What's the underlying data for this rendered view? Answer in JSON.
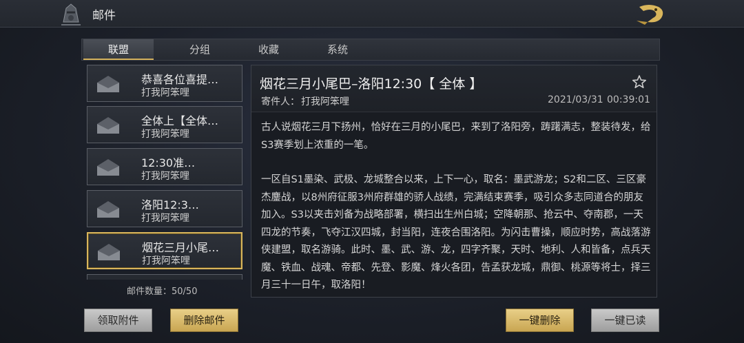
{
  "header": {
    "title": "邮件"
  },
  "tabs": [
    {
      "label": "联盟",
      "active": true
    },
    {
      "label": "分组",
      "active": false
    },
    {
      "label": "收藏",
      "active": false
    },
    {
      "label": "系统",
      "active": false
    }
  ],
  "mail_list": {
    "items": [
      {
        "subject": "恭喜各位喜提…",
        "sender": "打我阿笨哩",
        "selected": false
      },
      {
        "subject": "全体上【全体…",
        "sender": "打我阿笨哩",
        "selected": false
      },
      {
        "subject": "12:30准…",
        "sender": "打我阿笨哩",
        "selected": false
      },
      {
        "subject": "洛阳12:3…",
        "sender": "打我阿笨哩",
        "selected": false
      },
      {
        "subject": "烟花三月小尾…",
        "sender": "打我阿笨哩",
        "selected": true
      }
    ],
    "count_label": "邮件数量：50/50"
  },
  "detail": {
    "title": "烟花三月小尾巴–洛阳12:30【 全体 】",
    "from_label": "寄件人：",
    "from": "打我阿笨哩",
    "date": "2021/03/31",
    "time": "00:39:01",
    "body": [
      "古人说烟花三月下扬州，恰好在三月的小尾巴，来到了洛阳旁，踌躇满志，整装待发，给S3赛季划上浓重的一笔。",
      "一区自S1墨染、武极、龙城整合以来，上下一心，取名：墨武游龙；S2和二区、三区豪杰鏖战，以8州府征服3州府群雄的骄人战绩，完满结束赛季，吸引众多志同道合的朋友加入。S3以夹击刘备为战略部署，横扫出生州白城；空降朝那、抢云中、夺南郡，一天四龙的节奏，飞夺江汉四城，封当阳，连夜合围洛阳。为闪击曹操，顺应时势，高战落游侠建盟，取名游骑。此时、墨、武、游、龙，四字齐聚，天时、地利、人和皆备，点兵天魔、铁血、战魂、帝都、先登、影魔、烽火各团，告孟获龙城，鼎御、桃源等将士，择三月三十一日午，取洛阳！"
    ]
  },
  "buttons": {
    "claim_attachments": "领取附件",
    "delete_mail": "删除邮件",
    "delete_all": "一键删除",
    "read_all": "一键已读"
  },
  "colors": {
    "accent_gold": "#d9b65c",
    "panel_bg": "#191c22",
    "page_bg": "#1c2029"
  },
  "icons": [
    "back-helmet-icon",
    "dragon-logo-icon",
    "envelope-icon",
    "star-icon"
  ]
}
